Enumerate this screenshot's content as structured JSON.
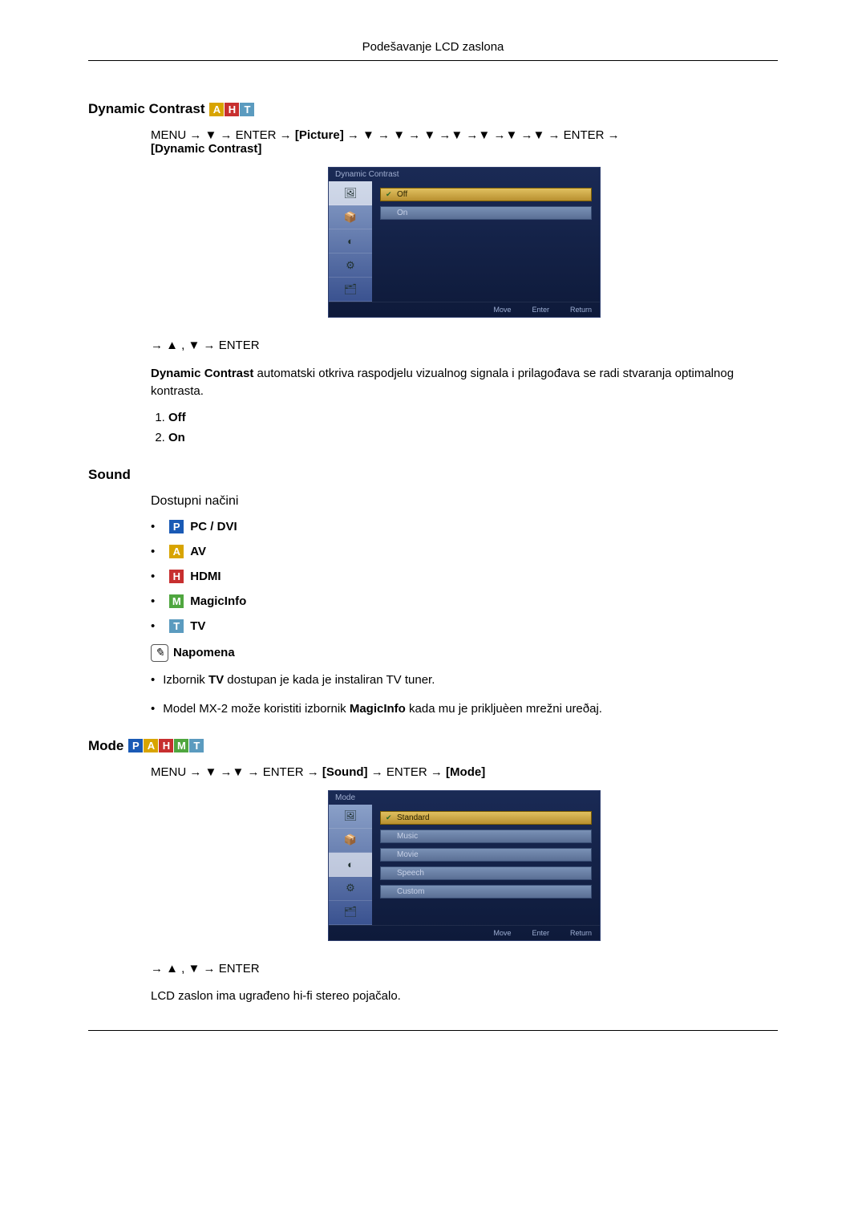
{
  "header": {
    "title": "Podešavanje LCD zaslona"
  },
  "dyncontrast": {
    "title": "Dynamic Contrast",
    "badges": [
      "A",
      "H",
      "T"
    ],
    "nav_pre": "MENU → ▼ → ENTER → ",
    "nav_picture": "[Picture]",
    "nav_mid": " → ▼ → ▼ → ▼ →▼ →▼ →▼ →▼ → ENTER → ",
    "nav_target": "[Dynamic Contrast]",
    "osd": {
      "title": "Dynamic Contrast",
      "options": [
        "Off",
        "On"
      ],
      "footer": {
        "move": "Move",
        "enter": "Enter",
        "return": "Return"
      }
    },
    "nav_after": "→ ▲ , ▼ → ENTER",
    "desc_bold": "Dynamic Contrast",
    "desc_rest": " automatski otkriva raspodjelu vizualnog signala i prilagođava se radi stvaranja optimalnog kontrasta.",
    "list": [
      "Off",
      "On"
    ]
  },
  "sound": {
    "title": "Sound",
    "modes_title": "Dostupni načini",
    "modes": [
      {
        "badge": "P",
        "label": "PC / DVI"
      },
      {
        "badge": "A",
        "label": "AV"
      },
      {
        "badge": "H",
        "label": "HDMI"
      },
      {
        "badge": "M",
        "label": "MagicInfo"
      },
      {
        "badge": "T",
        "label": "TV"
      }
    ],
    "note_label": "Napomena",
    "notes": [
      {
        "pre": "Izbornik ",
        "b": "TV",
        "post": " dostupan je kada je instaliran TV tuner."
      },
      {
        "pre": "Model MX-2 može koristiti izbornik ",
        "b": "MagicInfo",
        "post": " kada mu je prikljuèen mrežni ureðaj."
      }
    ]
  },
  "mode": {
    "title": "Mode",
    "badges": [
      "P",
      "A",
      "H",
      "M",
      "T"
    ],
    "nav_pre": "MENU → ▼ →▼ → ENTER → ",
    "nav_sound": "[Sound]",
    "nav_mid": " → ENTER → ",
    "nav_target": "[Mode]",
    "osd": {
      "title": "Mode",
      "options": [
        "Standard",
        "Music",
        "Movie",
        "Speech",
        "Custom"
      ],
      "footer": {
        "move": "Move",
        "enter": "Enter",
        "return": "Return"
      }
    },
    "nav_after": "→ ▲ , ▼ → ENTER",
    "desc": "LCD zaslon ima ugrađeno hi-fi stereo pojačalo."
  }
}
